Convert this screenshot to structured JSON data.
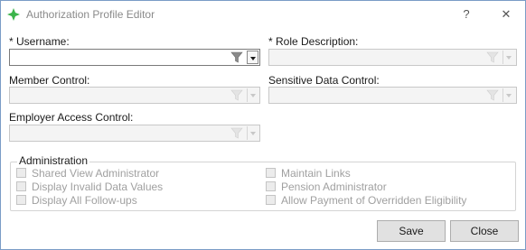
{
  "window": {
    "title": "Authorization Profile Editor",
    "help_glyph": "?",
    "close_glyph": "✕",
    "icon": "green-star-icon",
    "accent_color": "#3cb44b"
  },
  "fields": {
    "username": {
      "label": "* Username:",
      "value": ""
    },
    "role_description": {
      "label": "* Role Description:",
      "value": ""
    },
    "member_control": {
      "label": "Member Control:",
      "value": ""
    },
    "sensitive_data_control": {
      "label": "Sensitive Data Control:",
      "value": ""
    },
    "employer_access_control": {
      "label": "Employer Access Control:",
      "value": ""
    }
  },
  "administration": {
    "title": "Administration",
    "left": [
      {
        "label": "Shared View Administrator",
        "checked": false
      },
      {
        "label": "Display Invalid Data Values",
        "checked": false
      },
      {
        "label": "Display All Follow-ups",
        "checked": false
      }
    ],
    "right": [
      {
        "label": "Maintain Links",
        "checked": false
      },
      {
        "label": "Pension Administrator",
        "checked": false
      },
      {
        "label": "Allow Payment of Overridden Eligibility",
        "checked": false
      }
    ]
  },
  "buttons": {
    "save": "Save",
    "close": "Close"
  }
}
